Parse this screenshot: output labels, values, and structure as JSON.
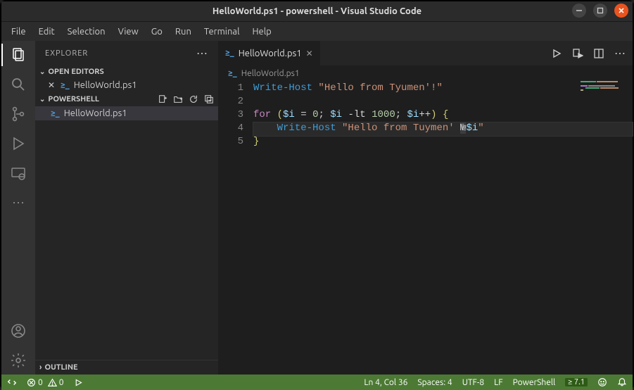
{
  "window": {
    "title": "HelloWorld.ps1 - powershell - Visual Studio Code"
  },
  "menu": {
    "items": [
      "File",
      "Edit",
      "Selection",
      "View",
      "Go",
      "Run",
      "Terminal",
      "Help"
    ]
  },
  "sidebar": {
    "title": "EXPLORER",
    "openEditorsLabel": "OPEN EDITORS",
    "openFile": "HelloWorld.ps1",
    "folderLabel": "POWERSHELL",
    "folderFile": "HelloWorld.ps1",
    "outlineLabel": "OUTLINE"
  },
  "tab": {
    "label": "HelloWorld.ps1"
  },
  "breadcrumb": {
    "file": "HelloWorld.ps1"
  },
  "code": {
    "lines": [
      {
        "n": 1,
        "segments": [
          [
            "Write-Host",
            "cmd"
          ],
          [
            " ",
            "op"
          ],
          [
            "\"Hello from Tyumen'!\"",
            "str"
          ]
        ]
      },
      {
        "n": 2,
        "segments": []
      },
      {
        "n": 3,
        "segments": [
          [
            "for",
            "kw"
          ],
          [
            " ",
            "op"
          ],
          [
            "(",
            "br"
          ],
          [
            "$i",
            "var"
          ],
          [
            " = ",
            "op"
          ],
          [
            "0",
            "num"
          ],
          [
            "; ",
            "op"
          ],
          [
            "$i",
            "var"
          ],
          [
            " ",
            "op"
          ],
          [
            "-lt",
            "op"
          ],
          [
            " ",
            "op"
          ],
          [
            "1000",
            "num"
          ],
          [
            "; ",
            "op"
          ],
          [
            "$i",
            "var"
          ],
          [
            "++",
            "op"
          ],
          [
            ")",
            "br"
          ],
          [
            " ",
            "op"
          ],
          [
            "{",
            "br"
          ]
        ]
      },
      {
        "n": 4,
        "current": true,
        "segments": [
          [
            "    ",
            "op"
          ],
          [
            "Write-Host",
            "cmd"
          ],
          [
            " ",
            "op"
          ],
          [
            "\"Hello from Tuymen' ",
            "str"
          ],
          [
            "№",
            "op-hl"
          ],
          [
            "$i",
            "var"
          ],
          [
            "\"",
            "str"
          ]
        ]
      },
      {
        "n": 5,
        "segments": [
          [
            "}",
            "br"
          ]
        ]
      }
    ]
  },
  "status": {
    "errors": "0",
    "warnings": "0",
    "cursor": "Ln 4, Col 36",
    "spaces": "Spaces: 4",
    "encoding": "UTF-8",
    "eol": "LF",
    "lang": "PowerShell",
    "psver": "7.1"
  }
}
